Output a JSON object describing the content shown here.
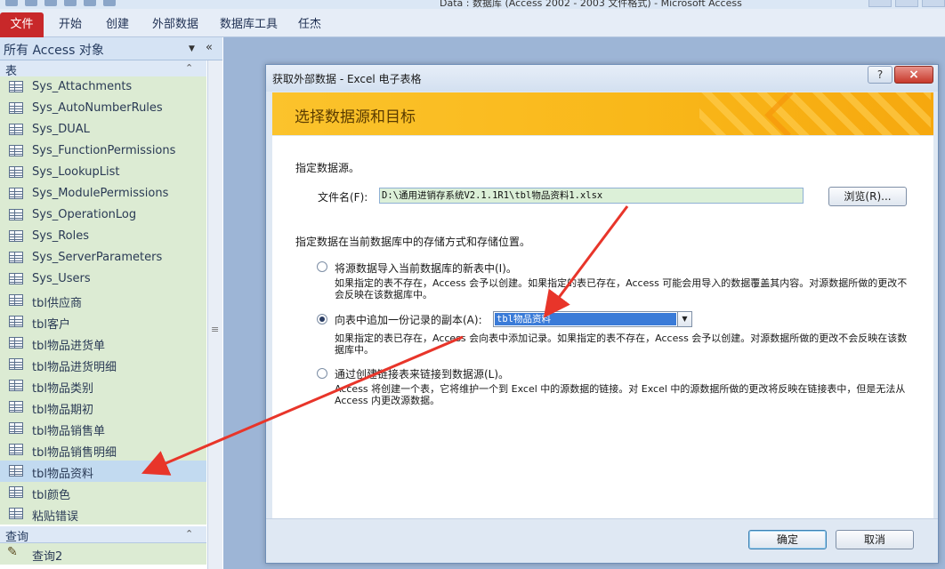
{
  "window": {
    "title": "Data : 数据库 (Access 2002 - 2003 文件格式) - Microsoft Access"
  },
  "ribbon": {
    "tabs": [
      "文件",
      "开始",
      "创建",
      "外部数据",
      "数据库工具",
      "任杰"
    ]
  },
  "nav": {
    "header": "所有 Access 对象",
    "group_tables": "表",
    "tables": [
      "Sys_Attachments",
      "Sys_AutoNumberRules",
      "Sys_DUAL",
      "Sys_FunctionPermissions",
      "Sys_LookupList",
      "Sys_ModulePermissions",
      "Sys_OperationLog",
      "Sys_Roles",
      "Sys_ServerParameters",
      "Sys_Users",
      "tbl供应商",
      "tbl客户",
      "tbl物品进货单",
      "tbl物品进货明细",
      "tbl物品类别",
      "tbl物品期初",
      "tbl物品销售单",
      "tbl物品销售明细",
      "tbl物品资料",
      "tbl颜色",
      "粘贴错误"
    ],
    "selected_table": "tbl物品资料",
    "group_queries": "查询",
    "queries": [
      "查询2"
    ]
  },
  "dialog": {
    "title": "获取外部数据 - Excel 电子表格",
    "help_label": "?",
    "close_label": "×",
    "banner_title": "选择数据源和目标",
    "specify_source": "指定数据源。",
    "filename_label": "文件名(F):",
    "filename_value": "D:\\通用进销存系统V2.1.1R1\\tbl物品资料1.xlsx",
    "browse_label": "浏览(R)...",
    "storage_prompt": "指定数据在当前数据库中的存储方式和存储位置。",
    "options": [
      {
        "label": "将源数据导入当前数据库的新表中(I)。",
        "desc": "如果指定的表不存在，Access 会予以创建。如果指定的表已存在，Access 可能会用导入的数据覆盖其内容。对源数据所做的更改不会反映在该数据库中。",
        "checked": false
      },
      {
        "label": "向表中追加一份记录的副本(A):",
        "desc": "如果指定的表已存在，Access 会向表中添加记录。如果指定的表不存在，Access 会予以创建。对源数据所做的更改不会反映在该数据库中。",
        "checked": true
      },
      {
        "label": "通过创建链接表来链接到数据源(L)。",
        "desc": "Access 将创建一个表，它将维护一个到 Excel 中的源数据的链接。对 Excel 中的源数据所做的更改将反映在链接表中，但是无法从 Access 内更改源数据。",
        "checked": false
      }
    ],
    "append_table": "tbl物品资料",
    "ok_label": "确定",
    "cancel_label": "取消"
  },
  "colors": {
    "file_tab": "#c8282a",
    "banner": "#f9b81a",
    "arrow": "#e8352a",
    "nav_item_bg": "#dcebd3"
  }
}
